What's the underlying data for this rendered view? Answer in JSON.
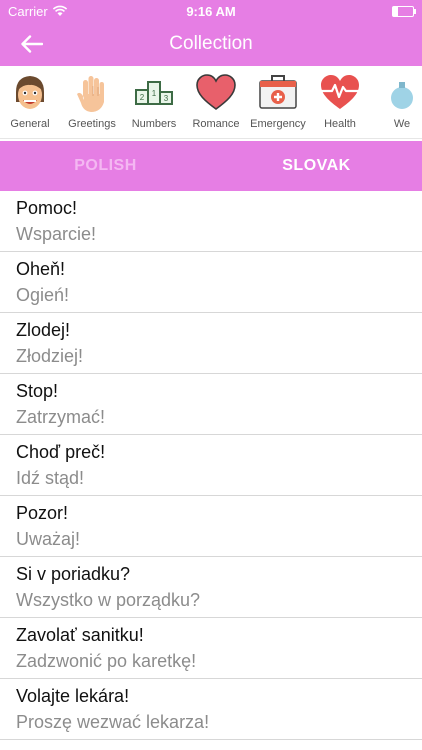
{
  "status": {
    "carrier": "Carrier",
    "time": "9:16 AM"
  },
  "nav": {
    "title": "Collection"
  },
  "categories": [
    {
      "label": "General",
      "icon": "face-icon"
    },
    {
      "label": "Greetings",
      "icon": "hand-icon"
    },
    {
      "label": "Numbers",
      "icon": "podium-icon"
    },
    {
      "label": "Romance",
      "icon": "heart-icon"
    },
    {
      "label": "Emergency",
      "icon": "first-aid-icon"
    },
    {
      "label": "Health",
      "icon": "heartbeat-icon"
    },
    {
      "label": "We",
      "icon": "more-icon"
    }
  ],
  "tabs": {
    "left": "POLISH",
    "right": "SLOVAK"
  },
  "colors": {
    "accent": "#e67ee4",
    "inactive_tab": "#f4b7f2"
  },
  "phrases": [
    {
      "src": "Pomoc!",
      "dst": "Wsparcie!"
    },
    {
      "src": "Oheň!",
      "dst": "Ogień!"
    },
    {
      "src": "Zlodej!",
      "dst": "Złodziej!"
    },
    {
      "src": "Stop!",
      "dst": "Zatrzymać!"
    },
    {
      "src": "Choď preč!",
      "dst": "Idź stąd!"
    },
    {
      "src": "Pozor!",
      "dst": "Uważaj!"
    },
    {
      "src": "Si v poriadku?",
      "dst": "Wszystko w porządku?"
    },
    {
      "src": "Zavolať sanitku!",
      "dst": "Zadzwonić po karetkę!"
    },
    {
      "src": "Volajte lekára!",
      "dst": "Proszę wezwać lekarza!"
    }
  ]
}
